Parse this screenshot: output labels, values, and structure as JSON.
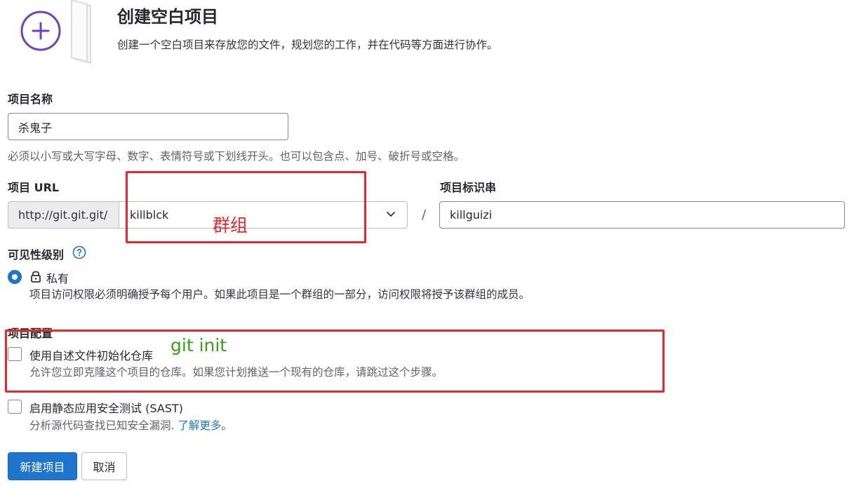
{
  "header": {
    "title": "创建空白项目",
    "description": "创建一个空白项目来存放您的文件，规划您的工作，并在代码等方面进行协作。"
  },
  "project_name": {
    "label": "项目名称",
    "value": "杀鬼子",
    "help": "必须以小写或大写字母、数字、表情符号或下划线开头。也可以包含点、加号、破折号或空格。"
  },
  "project_url": {
    "label": "项目 URL",
    "prefix": "http://git.git.git/",
    "namespace": "killblck",
    "separator": "/"
  },
  "project_slug": {
    "label": "项目标识串",
    "value": "killguizi"
  },
  "visibility": {
    "label": "可见性级别",
    "option_label": "私有",
    "option_desc": "项目访问权限必须明确授予每个用户。如果此项目是一个群组的一部分，访问权限将授予该群组的成员。",
    "selected": true
  },
  "config": {
    "label": "项目配置",
    "readme_label": "使用自述文件初始化仓库",
    "readme_desc": "允许您立即克隆这个项目的仓库。如果您计划推送一个现有的仓库，请跳过这个步骤。",
    "readme_checked": false,
    "sast_label": "启用静态应用安全测试 (SAST)",
    "sast_desc": "分析源代码查找已知安全漏洞.",
    "sast_link": "了解更多。",
    "sast_checked": false
  },
  "buttons": {
    "create": "新建项目",
    "cancel": "取消"
  },
  "annotations": {
    "group_note": "群组",
    "git_note": "git init",
    "box_color": "#e8282b",
    "git_note_color": "#36a21a"
  },
  "colors": {
    "primary": "#1f75cb",
    "icon_purple": "#6f42c1"
  },
  "icons": {
    "header": "plus-circle-icon",
    "select": "chevron-down-icon",
    "help": "question-circle-icon",
    "visibility": "lock-icon"
  }
}
